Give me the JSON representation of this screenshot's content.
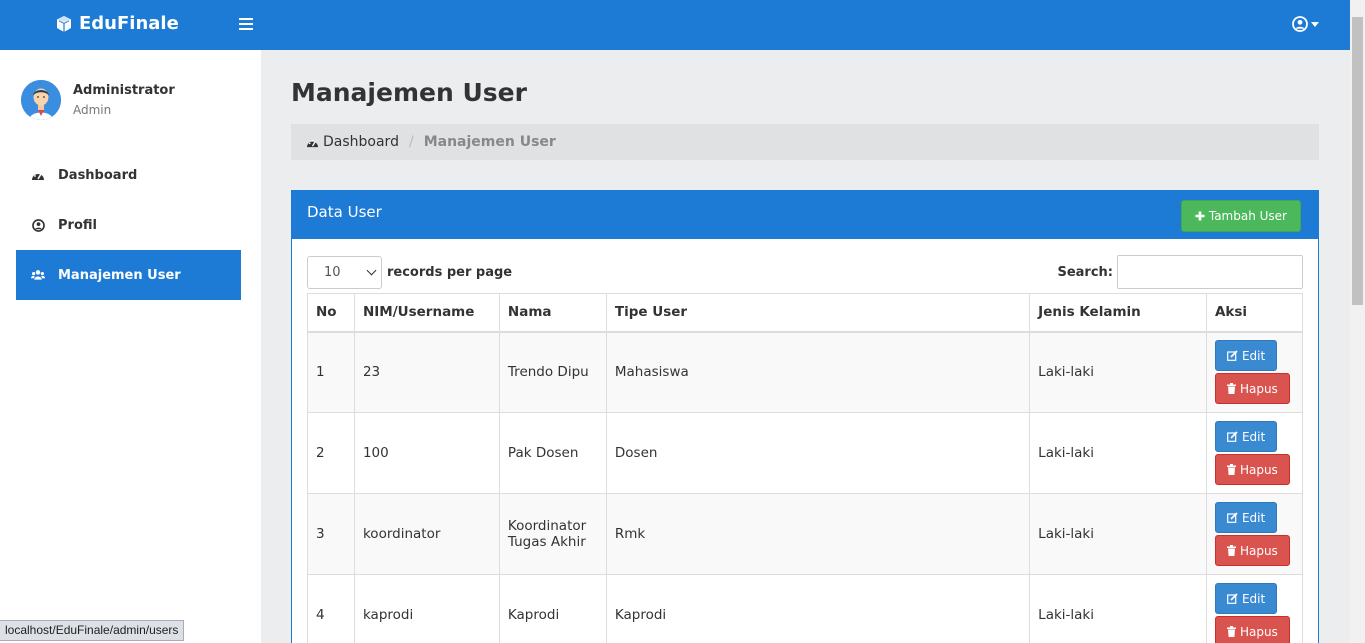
{
  "app": {
    "title": "EduFinale"
  },
  "sidebar": {
    "user_name": "Administrator",
    "user_role": "Admin",
    "items": [
      {
        "label": "Dashboard",
        "icon": "dashboard-icon"
      },
      {
        "label": "Profil",
        "icon": "user-circle-icon"
      },
      {
        "label": "Manajemen User",
        "icon": "users-icon",
        "active": true
      }
    ]
  },
  "page": {
    "title": "Manajemen User",
    "breadcrumb": {
      "home": "Dashboard",
      "current": "Manajemen User"
    }
  },
  "panel": {
    "title": "Data User",
    "add_button": "Tambah User",
    "page_size": "10",
    "records_label": "records per page",
    "search_label": "Search:",
    "search_value": ""
  },
  "table": {
    "headers": [
      "No",
      "NIM/Username",
      "Nama",
      "Tipe User",
      "Jenis Kelamin",
      "Aksi"
    ],
    "rows": [
      {
        "no": "1",
        "username": "23",
        "nama": "Trendo Dipu",
        "tipe": "Mahasiswa",
        "jk": "Laki-laki"
      },
      {
        "no": "2",
        "username": "100",
        "nama": "Pak Dosen",
        "tipe": "Dosen",
        "jk": "Laki-laki"
      },
      {
        "no": "3",
        "username": "koordinator",
        "nama": "Koordinator Tugas Akhir",
        "tipe": "Rmk",
        "jk": "Laki-laki"
      },
      {
        "no": "4",
        "username": "kaprodi",
        "nama": "Kaprodi",
        "tipe": "Kaprodi",
        "jk": "Laki-laki"
      }
    ],
    "edit_label": "Edit",
    "delete_label": "Hapus"
  },
  "status_url": "localhost/EduFinale/admin/users",
  "colors": {
    "primary": "#1d7bd6",
    "success": "#4cb85c",
    "danger": "#d9534f",
    "info": "#3a8ad2"
  }
}
